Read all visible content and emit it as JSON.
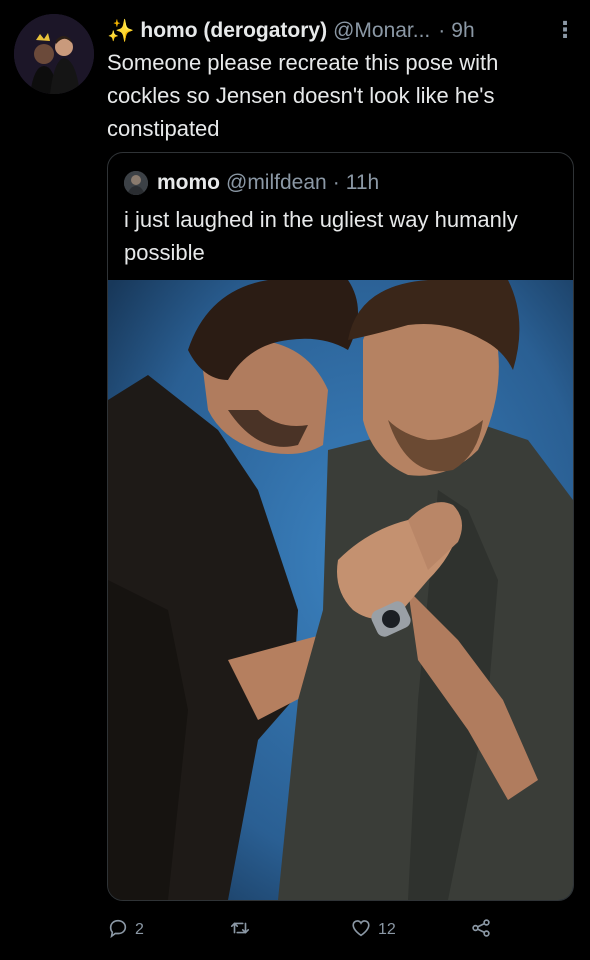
{
  "tweet": {
    "display_name": "homo (derogatory)",
    "handle": "@Monar...",
    "separator": "·",
    "time": "9h",
    "text": "Someone please recreate this pose with cockles so Jensen doesn't look like he's constipated",
    "sparkle_icon": "✨"
  },
  "quoted": {
    "display_name": "momo",
    "handle": "@milfdean",
    "separator": "·",
    "time": "11h",
    "text": "i just laughed in the ugliest way humanly possible"
  },
  "actions": {
    "reply_count": "2",
    "like_count": "12"
  },
  "colors": {
    "background": "#000000",
    "text": "#e7e9ea",
    "muted": "#8b98a5",
    "border": "#2f3336",
    "photo_backdrop": "#2f6fa8"
  }
}
